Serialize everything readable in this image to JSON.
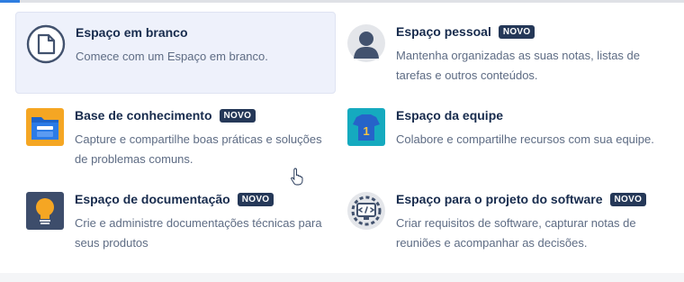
{
  "options": [
    {
      "title": "Espaço em branco",
      "badge": "",
      "description": "Comece com um Espaço em branco.",
      "icon": "blank-page-icon"
    },
    {
      "title": "Espaço pessoal",
      "badge": "NOVO",
      "description": "Mantenha organizadas as suas notas, listas de tarefas e outros conteúdos.",
      "icon": "person-avatar-icon"
    },
    {
      "title": "Base de conhecimento",
      "badge": "NOVO",
      "description": "Capture e compartilhe boas práticas e soluções de problemas comuns.",
      "icon": "folder-icon"
    },
    {
      "title": "Espaço da equipe",
      "badge": "",
      "description": "Colabore e compartilhe recursos com sua equipe.",
      "icon": "team-jersey-icon"
    },
    {
      "title": "Espaço de documentação",
      "badge": "NOVO",
      "description": "Crie e administre documentações técnicas para seus produtos",
      "icon": "lightbulb-icon"
    },
    {
      "title": "Espaço para o projeto do software",
      "badge": "NOVO",
      "description": "Criar requisitos de software, capturar notas de reuniões e acompanhar as decisões.",
      "icon": "code-gear-icon"
    }
  ],
  "colors": {
    "selected_bg": "#eef1fb",
    "badge_bg": "#253858",
    "title": "#172b4d",
    "description": "#5e6c84"
  }
}
